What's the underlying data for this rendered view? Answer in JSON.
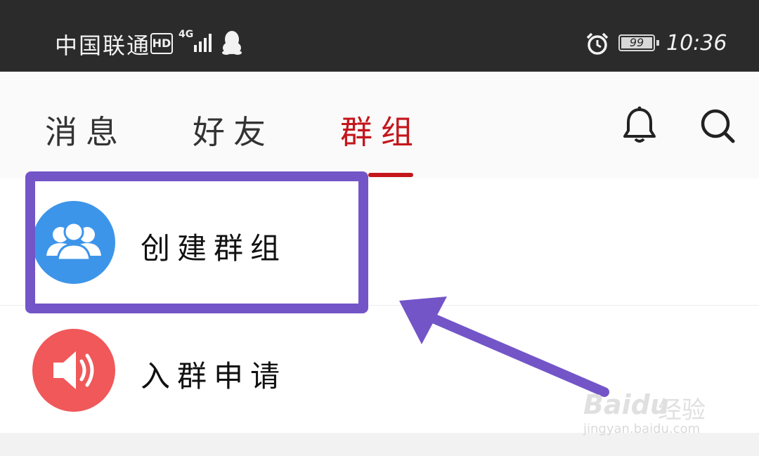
{
  "status_bar": {
    "carrier": "中国联通",
    "hd_badge": "HD",
    "network": "4G",
    "battery_level": "99",
    "time": "10:36",
    "icons": [
      "signal-icon",
      "qq-icon",
      "alarm-icon",
      "battery-icon"
    ]
  },
  "tabs": [
    {
      "label": "消息",
      "active": false
    },
    {
      "label": "好友",
      "active": false
    },
    {
      "label": "群组",
      "active": true
    }
  ],
  "header_actions": [
    "bell-icon",
    "search-icon"
  ],
  "list": [
    {
      "label": "创建群组",
      "icon": "group-icon",
      "color": "#3d95ea"
    },
    {
      "label": "入群申请",
      "icon": "speaker-icon",
      "color": "#f0585a"
    }
  ],
  "colors": {
    "active_tab": "#c4161c",
    "annotation": "#7355c8"
  },
  "watermark": {
    "brand": "Baidu",
    "product": "经验",
    "url": "jingyan.baidu.com"
  }
}
